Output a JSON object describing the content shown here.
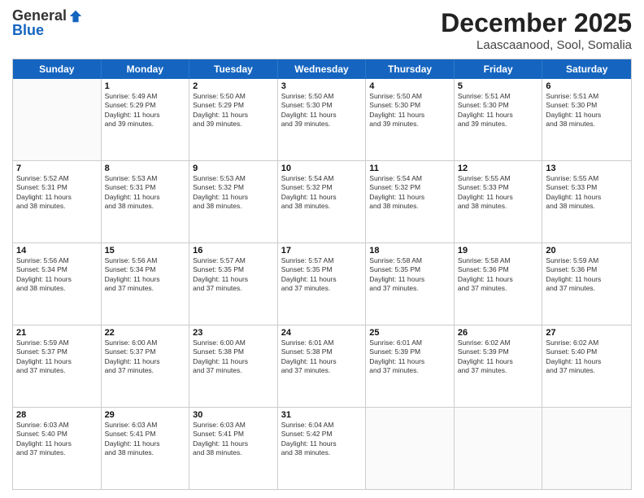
{
  "logo": {
    "general": "General",
    "blue": "Blue"
  },
  "title": "December 2025",
  "subtitle": "Laascaanood, Sool, Somalia",
  "days": [
    "Sunday",
    "Monday",
    "Tuesday",
    "Wednesday",
    "Thursday",
    "Friday",
    "Saturday"
  ],
  "weeks": [
    [
      {
        "day": "",
        "info": ""
      },
      {
        "day": "1",
        "info": "Sunrise: 5:49 AM\nSunset: 5:29 PM\nDaylight: 11 hours\nand 39 minutes."
      },
      {
        "day": "2",
        "info": "Sunrise: 5:50 AM\nSunset: 5:29 PM\nDaylight: 11 hours\nand 39 minutes."
      },
      {
        "day": "3",
        "info": "Sunrise: 5:50 AM\nSunset: 5:30 PM\nDaylight: 11 hours\nand 39 minutes."
      },
      {
        "day": "4",
        "info": "Sunrise: 5:50 AM\nSunset: 5:30 PM\nDaylight: 11 hours\nand 39 minutes."
      },
      {
        "day": "5",
        "info": "Sunrise: 5:51 AM\nSunset: 5:30 PM\nDaylight: 11 hours\nand 39 minutes."
      },
      {
        "day": "6",
        "info": "Sunrise: 5:51 AM\nSunset: 5:30 PM\nDaylight: 11 hours\nand 38 minutes."
      }
    ],
    [
      {
        "day": "7",
        "info": "Sunrise: 5:52 AM\nSunset: 5:31 PM\nDaylight: 11 hours\nand 38 minutes."
      },
      {
        "day": "8",
        "info": "Sunrise: 5:53 AM\nSunset: 5:31 PM\nDaylight: 11 hours\nand 38 minutes."
      },
      {
        "day": "9",
        "info": "Sunrise: 5:53 AM\nSunset: 5:32 PM\nDaylight: 11 hours\nand 38 minutes."
      },
      {
        "day": "10",
        "info": "Sunrise: 5:54 AM\nSunset: 5:32 PM\nDaylight: 11 hours\nand 38 minutes."
      },
      {
        "day": "11",
        "info": "Sunrise: 5:54 AM\nSunset: 5:32 PM\nDaylight: 11 hours\nand 38 minutes."
      },
      {
        "day": "12",
        "info": "Sunrise: 5:55 AM\nSunset: 5:33 PM\nDaylight: 11 hours\nand 38 minutes."
      },
      {
        "day": "13",
        "info": "Sunrise: 5:55 AM\nSunset: 5:33 PM\nDaylight: 11 hours\nand 38 minutes."
      }
    ],
    [
      {
        "day": "14",
        "info": "Sunrise: 5:56 AM\nSunset: 5:34 PM\nDaylight: 11 hours\nand 38 minutes."
      },
      {
        "day": "15",
        "info": "Sunrise: 5:56 AM\nSunset: 5:34 PM\nDaylight: 11 hours\nand 37 minutes."
      },
      {
        "day": "16",
        "info": "Sunrise: 5:57 AM\nSunset: 5:35 PM\nDaylight: 11 hours\nand 37 minutes."
      },
      {
        "day": "17",
        "info": "Sunrise: 5:57 AM\nSunset: 5:35 PM\nDaylight: 11 hours\nand 37 minutes."
      },
      {
        "day": "18",
        "info": "Sunrise: 5:58 AM\nSunset: 5:35 PM\nDaylight: 11 hours\nand 37 minutes."
      },
      {
        "day": "19",
        "info": "Sunrise: 5:58 AM\nSunset: 5:36 PM\nDaylight: 11 hours\nand 37 minutes."
      },
      {
        "day": "20",
        "info": "Sunrise: 5:59 AM\nSunset: 5:36 PM\nDaylight: 11 hours\nand 37 minutes."
      }
    ],
    [
      {
        "day": "21",
        "info": "Sunrise: 5:59 AM\nSunset: 5:37 PM\nDaylight: 11 hours\nand 37 minutes."
      },
      {
        "day": "22",
        "info": "Sunrise: 6:00 AM\nSunset: 5:37 PM\nDaylight: 11 hours\nand 37 minutes."
      },
      {
        "day": "23",
        "info": "Sunrise: 6:00 AM\nSunset: 5:38 PM\nDaylight: 11 hours\nand 37 minutes."
      },
      {
        "day": "24",
        "info": "Sunrise: 6:01 AM\nSunset: 5:38 PM\nDaylight: 11 hours\nand 37 minutes."
      },
      {
        "day": "25",
        "info": "Sunrise: 6:01 AM\nSunset: 5:39 PM\nDaylight: 11 hours\nand 37 minutes."
      },
      {
        "day": "26",
        "info": "Sunrise: 6:02 AM\nSunset: 5:39 PM\nDaylight: 11 hours\nand 37 minutes."
      },
      {
        "day": "27",
        "info": "Sunrise: 6:02 AM\nSunset: 5:40 PM\nDaylight: 11 hours\nand 37 minutes."
      }
    ],
    [
      {
        "day": "28",
        "info": "Sunrise: 6:03 AM\nSunset: 5:40 PM\nDaylight: 11 hours\nand 37 minutes."
      },
      {
        "day": "29",
        "info": "Sunrise: 6:03 AM\nSunset: 5:41 PM\nDaylight: 11 hours\nand 38 minutes."
      },
      {
        "day": "30",
        "info": "Sunrise: 6:03 AM\nSunset: 5:41 PM\nDaylight: 11 hours\nand 38 minutes."
      },
      {
        "day": "31",
        "info": "Sunrise: 6:04 AM\nSunset: 5:42 PM\nDaylight: 11 hours\nand 38 minutes."
      },
      {
        "day": "",
        "info": ""
      },
      {
        "day": "",
        "info": ""
      },
      {
        "day": "",
        "info": ""
      }
    ]
  ]
}
